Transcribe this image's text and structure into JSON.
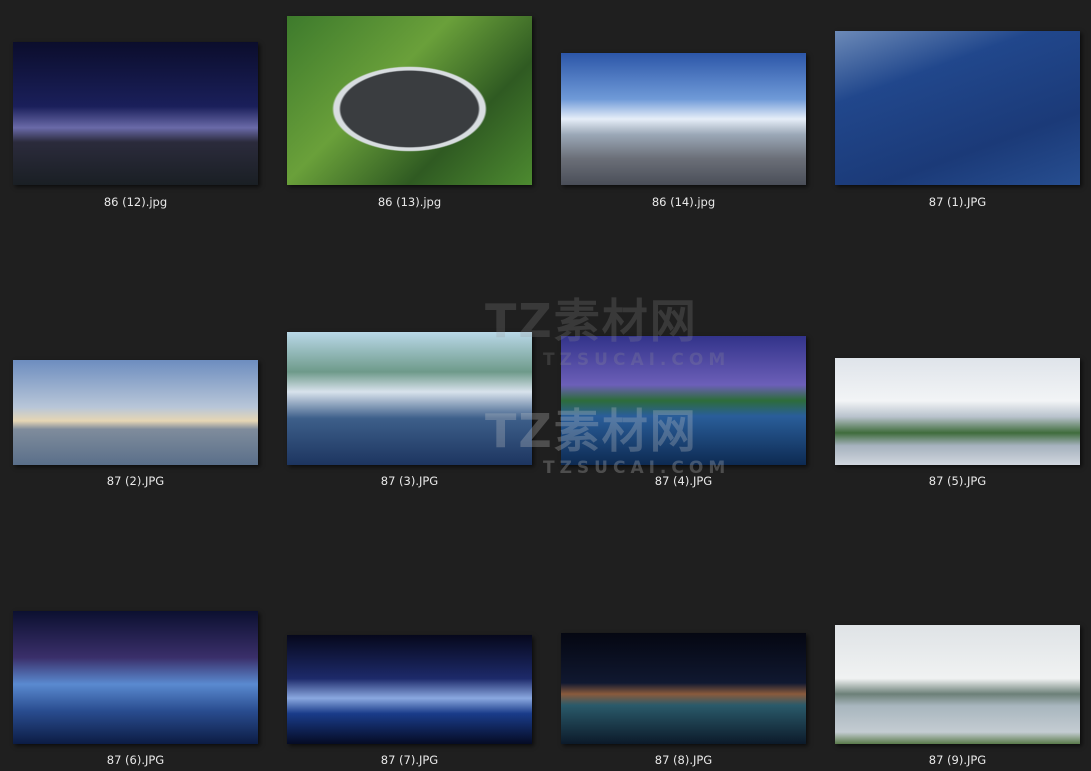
{
  "files": [
    {
      "name": "86 (12).jpg"
    },
    {
      "name": "86 (13).jpg"
    },
    {
      "name": "86 (14).jpg"
    },
    {
      "name": "87 (1).JPG"
    },
    {
      "name": "87 (2).JPG"
    },
    {
      "name": "87 (3).JPG"
    },
    {
      "name": "87 (4).JPG"
    },
    {
      "name": "87 (5).JPG"
    },
    {
      "name": "87 (6).JPG"
    },
    {
      "name": "87 (7).JPG"
    },
    {
      "name": "87 (8).JPG"
    },
    {
      "name": "87 (9).JPG"
    }
  ],
  "watermark": {
    "brand": "TZ素材网",
    "domain": "TZSUCAI.COM"
  }
}
